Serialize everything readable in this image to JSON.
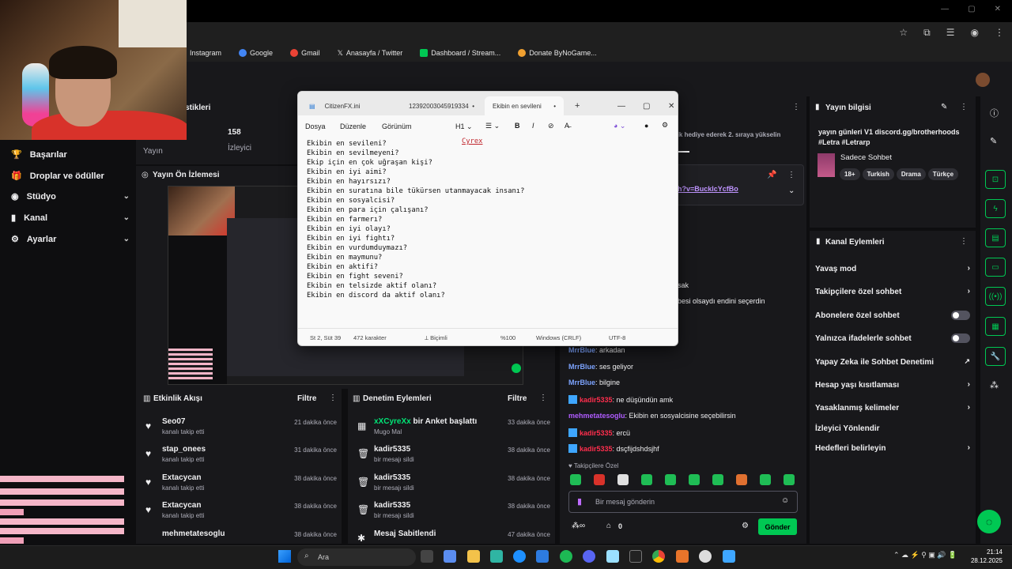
{
  "bookmarks": [
    "Instagram",
    "Google",
    "Gmail",
    "Anasayfa / Twitter",
    "Dashboard / Stream...",
    "Donate ByNoGame..."
  ],
  "sidebar": {
    "items": [
      {
        "label": "Başarılar",
        "has_chevron": false
      },
      {
        "label": "Droplar ve ödüller",
        "has_chevron": false
      },
      {
        "label": "Stüdyo",
        "has_chevron": true
      },
      {
        "label": "Kanal",
        "has_chevron": true
      },
      {
        "label": "Ayarlar",
        "has_chevron": true
      }
    ]
  },
  "stats": {
    "title": "tistikleri",
    "col1_label": "Yayın",
    "value": "158",
    "value_label": "İzleyici"
  },
  "preview": {
    "title": "Yayın Ön İzlemesi"
  },
  "activity": {
    "title": "Etkinlik Akışı",
    "filter": "Filtre",
    "items": [
      {
        "name": "Seo07",
        "action": "kanalı takip etti",
        "time": "21 dakika önce"
      },
      {
        "name": "stap_onees",
        "action": "kanalı takip etti",
        "time": "31 dakika önce"
      },
      {
        "name": "Extacycan",
        "action": "kanalı takip etti",
        "time": "38 dakika önce"
      },
      {
        "name": "Extacycan",
        "action": "kanalı takip etti",
        "time": "38 dakika önce"
      },
      {
        "name": "mehmetatesoglu",
        "action": "",
        "time": "38 dakika önce"
      }
    ]
  },
  "modlog": {
    "title": "Denetim Eylemleri",
    "filter": "Filtre",
    "items": [
      {
        "name": "xXCyreXx",
        "name_suffix": " bir Anket başlattı",
        "action": "Mugo Mal",
        "time": "33 dakika önce"
      },
      {
        "name": "kadir5335",
        "name_suffix": "",
        "action": "bir mesajı sildi",
        "time": "38 dakika önce"
      },
      {
        "name": "kadir5335",
        "name_suffix": "",
        "action": "bir mesajı sildi",
        "time": "38 dakika önce"
      },
      {
        "name": "kadir5335",
        "name_suffix": "",
        "action": "bir mesajı sildi",
        "time": "38 dakika önce"
      },
      {
        "name": "Mesaj Sabitlendi",
        "name_suffix": "",
        "action": "",
        "time": "47 dakika önce"
      }
    ]
  },
  "chat": {
    "top_banner": "elik hediye ederek 2. sıraya yükselin",
    "pinned_link": "ch?v=BucklcYcfBo",
    "partial_1": "sak",
    "partial_2": "besi olsaydı endini seçerdin",
    "messages": [
      {
        "user": "MrrBlue",
        "color": "#7da4ff",
        "badge": false,
        "text": ": arkadan"
      },
      {
        "user": "MrrBlue",
        "color": "#7da4ff",
        "badge": false,
        "text": ": ses geliyor"
      },
      {
        "user": "MrrBlue",
        "color": "#7da4ff",
        "badge": false,
        "text": ": bilgine"
      },
      {
        "user": "kadir5335",
        "color": "#ff2e4d",
        "badge": true,
        "text": ": ne düşündün amk"
      },
      {
        "user": "mehmetatesoglu",
        "color": "#b05cff",
        "badge": false,
        "text": ": Ekibin en sosyalcisine seçebilirsin"
      },
      {
        "user": "kadir5335",
        "color": "#ff2e4d",
        "badge": true,
        "text": ": ercü"
      },
      {
        "user": "kadir5335",
        "color": "#ff2e4d",
        "badge": true,
        "text": ": dsçfijdshdsjhf"
      }
    ],
    "followers_only": "Takipçilere Özel",
    "input_placeholder": "Bir mesaj gönderin",
    "points": "0",
    "send_label": "Gönder"
  },
  "stream_info": {
    "title": "Yayın bilgisi",
    "stream_title": "yayın günleri V1 discord.gg/brotherhoods #Letra #Letrarp",
    "category": "Sadece Sohbet",
    "tags": [
      "18+",
      "Turkish",
      "Drama",
      "Türkçe"
    ]
  },
  "channel_actions": {
    "title": "Kanal Eylemleri",
    "rows": [
      {
        "label": "Yavaş mod",
        "control": "chevron"
      },
      {
        "label": "Takipçilere özel sohbet",
        "control": "chevron"
      },
      {
        "label": "Abonelere özel sohbet",
        "control": "toggle"
      },
      {
        "label": "Yalnızca ifadelerle sohbet",
        "control": "toggle"
      },
      {
        "label": "Yapay Zeka ile Sohbet Denetimi",
        "control": "external"
      },
      {
        "label": "Hesap yaşı kısıtlaması",
        "control": "chevron"
      },
      {
        "label": "Yasaklanmış kelimeler",
        "control": "chevron"
      },
      {
        "label": "İzleyici Yönlendir",
        "control": "none"
      },
      {
        "label": "Hedefleri belirleyin",
        "control": "chevron"
      }
    ]
  },
  "notepad": {
    "tabs": [
      "CitizenFX.ini",
      "12392003045919334",
      "Ekibin en sevileni"
    ],
    "menu": [
      "Dosya",
      "Düzenle",
      "Görünüm"
    ],
    "heading": "H1",
    "annotation": "Cyrex",
    "lines": [
      "Ekibin en sevileni?",
      "Ekibin en sevilmeyeni?",
      "Ekip için en çok uğraşan kişi?",
      "Ekibin en iyi aimi?",
      "Ekibin en hayırsızı?",
      "Ekibin en suratına bile tükürsen utanmayacak insanı?",
      "Ekibin en sosyalcisi?",
      "Ekibin en para için çalışanı?",
      "Ekibin en farmerı?",
      "Ekibin en iyi olayı?",
      "Ekibin en iyi fightı?",
      "Ekibin en vurdumduymazı?",
      "Ekibin en maymunu?",
      "Ekibin en aktifi?",
      "Ekibin en fight seveni?",
      "Ekibin en telsizde aktif olanı?",
      "Ekibin en discord da aktif olanı?"
    ],
    "status": {
      "position": "St 2, Süt 39",
      "chars": "472 karakter",
      "format": "Biçimli",
      "zoom": "%100",
      "eol": "Windows (CRLF)",
      "encoding": "UTF-8"
    }
  },
  "taskbar": {
    "search_placeholder": "Ara",
    "time": "21:14",
    "date": "28.12.2025"
  }
}
